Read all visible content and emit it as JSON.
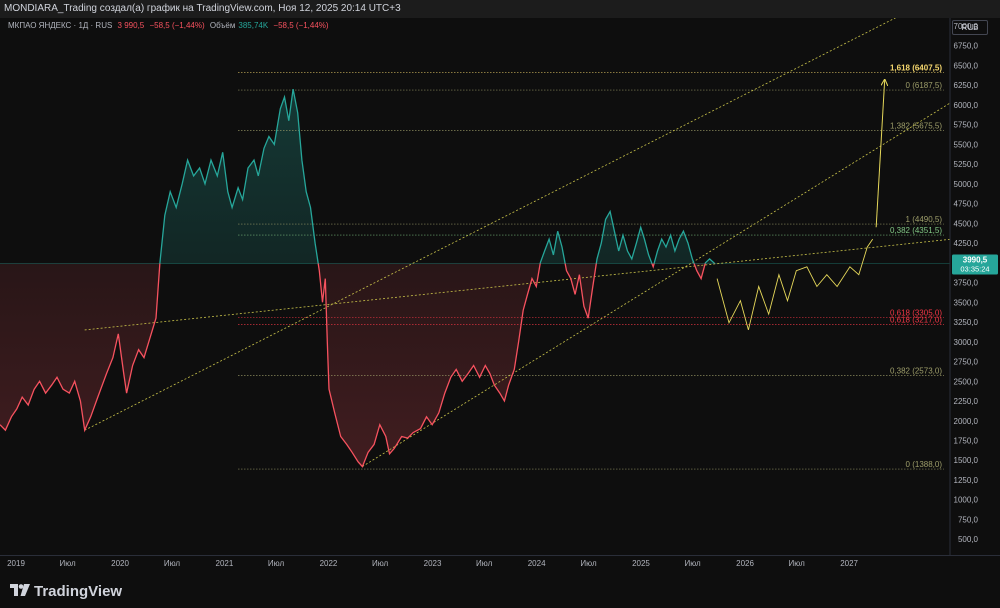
{
  "header": {
    "title": "MONDIARA_Trading создал(а) график на TradingView.com, Ноя 12, 2025 20:14 UTC+3"
  },
  "legend": {
    "symbol": "МКПАО ЯНДЕКС · 1Д · RUS",
    "price": "3 990,5",
    "change": "−58,5 (−1,44%)",
    "volume_label": "Объём",
    "volume_value": "385,74K",
    "volume_change": "−58,5 (−1,44%)"
  },
  "currency": "RUB",
  "price_tag": {
    "price": "3990,5",
    "countdown": "03:35:24"
  },
  "footer": {
    "brand": "TradingView",
    "logo_icon": "tradingview-logo-icon"
  },
  "colors": {
    "bull": "#26a69a",
    "bear": "#f7525f",
    "fib_line": "#9e9e6a",
    "fib_highlight": "#f5d76e",
    "fib_red": "#f23645",
    "fib_green": "#81c784",
    "trend": "#c9c34a"
  },
  "chart_data": {
    "type": "line",
    "title": "",
    "xlabel": "",
    "ylabel": "",
    "ylim": [
      300,
      7100
    ],
    "y_ticks": [
      500,
      750,
      1000,
      1250,
      1500,
      1750,
      2000,
      2250,
      2500,
      2750,
      3000,
      3250,
      3500,
      3750,
      4000,
      4250,
      4500,
      4750,
      5000,
      5250,
      5500,
      5750,
      6000,
      6250,
      6500,
      6750,
      7000
    ],
    "y_tick_labels": [
      "500,0",
      "750,0",
      "1000,0",
      "1250,0",
      "1500,0",
      "1750,0",
      "2000,0",
      "2250,0",
      "2500,0",
      "2750,0",
      "3000,0",
      "3250,0",
      "3500,0",
      "3750,0",
      "4000,0",
      "4250,0",
      "4500,0",
      "4750,0",
      "5000,0",
      "5250,0",
      "5500,0",
      "5750,0",
      "6000,0",
      "6250,0",
      "6500,0",
      "6750,0",
      "7000,0"
    ],
    "x_range": [
      "2019-01-01",
      "2028-02-15"
    ],
    "x_ticks": [
      {
        "date": "2019-01-01",
        "label": "2019"
      },
      {
        "date": "2019-07-01",
        "label": "Июл"
      },
      {
        "date": "2020-01-01",
        "label": "2020"
      },
      {
        "date": "2020-07-01",
        "label": "Июл"
      },
      {
        "date": "2021-01-01",
        "label": "2021"
      },
      {
        "date": "2021-07-01",
        "label": "Июл"
      },
      {
        "date": "2022-01-01",
        "label": "2022"
      },
      {
        "date": "2022-07-01",
        "label": "Июл"
      },
      {
        "date": "2023-01-01",
        "label": "2023"
      },
      {
        "date": "2023-07-01",
        "label": "Июл"
      },
      {
        "date": "2024-01-01",
        "label": "2024"
      },
      {
        "date": "2024-07-01",
        "label": "Июл"
      },
      {
        "date": "2025-01-01",
        "label": "2025"
      },
      {
        "date": "2025-07-01",
        "label": "Июл"
      },
      {
        "date": "2026-01-01",
        "label": "2026"
      },
      {
        "date": "2026-07-01",
        "label": "Июл"
      },
      {
        "date": "2027-01-01",
        "label": "2027"
      }
    ],
    "baseline": 3990.5,
    "series": [
      {
        "name": "МКПАО ЯНДЕКС",
        "points": [
          [
            "2019-01-01",
            1950
          ],
          [
            "2019-01-20",
            1880
          ],
          [
            "2019-02-10",
            2050
          ],
          [
            "2019-03-01",
            2150
          ],
          [
            "2019-03-20",
            2300
          ],
          [
            "2019-04-10",
            2200
          ],
          [
            "2019-05-01",
            2400
          ],
          [
            "2019-05-20",
            2500
          ],
          [
            "2019-06-10",
            2350
          ],
          [
            "2019-07-01",
            2450
          ],
          [
            "2019-07-20",
            2550
          ],
          [
            "2019-08-10",
            2400
          ],
          [
            "2019-09-01",
            2350
          ],
          [
            "2019-09-20",
            2500
          ],
          [
            "2019-10-10",
            2250
          ],
          [
            "2019-10-25",
            1880
          ],
          [
            "2019-11-15",
            2050
          ],
          [
            "2019-12-10",
            2300
          ],
          [
            "2020-01-10",
            2600
          ],
          [
            "2020-02-01",
            2800
          ],
          [
            "2020-02-20",
            3100
          ],
          [
            "2020-03-10",
            2600
          ],
          [
            "2020-03-20",
            2350
          ],
          [
            "2020-04-10",
            2700
          ],
          [
            "2020-05-01",
            2900
          ],
          [
            "2020-05-20",
            2800
          ],
          [
            "2020-06-10",
            3050
          ],
          [
            "2020-07-01",
            3300
          ],
          [
            "2020-07-15",
            4000
          ],
          [
            "2020-08-01",
            4600
          ],
          [
            "2020-08-20",
            4900
          ],
          [
            "2020-09-10",
            4700
          ],
          [
            "2020-10-01",
            5000
          ],
          [
            "2020-10-20",
            5300
          ],
          [
            "2020-11-10",
            5100
          ],
          [
            "2020-12-01",
            5200
          ],
          [
            "2020-12-20",
            5000
          ],
          [
            "2021-01-10",
            5300
          ],
          [
            "2021-02-01",
            5100
          ],
          [
            "2021-02-20",
            5400
          ],
          [
            "2021-03-10",
            4900
          ],
          [
            "2021-03-25",
            4700
          ],
          [
            "2021-04-15",
            4950
          ],
          [
            "2021-05-01",
            4800
          ],
          [
            "2021-05-20",
            5200
          ],
          [
            "2021-06-10",
            5300
          ],
          [
            "2021-06-25",
            5100
          ],
          [
            "2021-07-15",
            5450
          ],
          [
            "2021-08-01",
            5600
          ],
          [
            "2021-08-20",
            5500
          ],
          [
            "2021-09-10",
            5950
          ],
          [
            "2021-09-25",
            6100
          ],
          [
            "2021-10-10",
            5800
          ],
          [
            "2021-10-25",
            6200
          ],
          [
            "2021-11-10",
            5900
          ],
          [
            "2021-11-25",
            5300
          ],
          [
            "2021-12-10",
            4900
          ],
          [
            "2021-12-25",
            4700
          ],
          [
            "2022-01-10",
            4250
          ],
          [
            "2022-01-25",
            3900
          ],
          [
            "2022-02-05",
            3500
          ],
          [
            "2022-02-15",
            3800
          ],
          [
            "2022-02-22",
            3000
          ],
          [
            "2022-02-28",
            2400
          ],
          [
            "2022-03-20",
            2100
          ],
          [
            "2022-04-10",
            1800
          ],
          [
            "2022-05-01",
            1700
          ],
          [
            "2022-05-20",
            1600
          ],
          [
            "2022-06-10",
            1480
          ],
          [
            "2022-06-25",
            1420
          ],
          [
            "2022-07-15",
            1600
          ],
          [
            "2022-08-05",
            1700
          ],
          [
            "2022-08-25",
            1950
          ],
          [
            "2022-09-15",
            1800
          ],
          [
            "2022-09-28",
            1580
          ],
          [
            "2022-10-15",
            1650
          ],
          [
            "2022-11-10",
            1800
          ],
          [
            "2022-12-01",
            1780
          ],
          [
            "2022-12-20",
            1850
          ],
          [
            "2023-01-15",
            1900
          ],
          [
            "2023-02-05",
            2050
          ],
          [
            "2023-02-25",
            1950
          ],
          [
            "2023-03-20",
            2100
          ],
          [
            "2023-04-10",
            2350
          ],
          [
            "2023-05-01",
            2550
          ],
          [
            "2023-05-20",
            2650
          ],
          [
            "2023-06-10",
            2500
          ],
          [
            "2023-07-01",
            2600
          ],
          [
            "2023-07-20",
            2700
          ],
          [
            "2023-08-10",
            2550
          ],
          [
            "2023-08-30",
            2700
          ],
          [
            "2023-09-15",
            2600
          ],
          [
            "2023-10-01",
            2450
          ],
          [
            "2023-10-20",
            2350
          ],
          [
            "2023-11-05",
            2250
          ],
          [
            "2023-11-20",
            2450
          ],
          [
            "2023-12-10",
            2650
          ],
          [
            "2023-12-25",
            3000
          ],
          [
            "2024-01-10",
            3400
          ],
          [
            "2024-01-25",
            3600
          ],
          [
            "2024-02-10",
            3800
          ],
          [
            "2024-02-25",
            3700
          ],
          [
            "2024-03-10",
            4000
          ],
          [
            "2024-03-25",
            4150
          ],
          [
            "2024-04-10",
            4300
          ],
          [
            "2024-04-25",
            4100
          ],
          [
            "2024-05-10",
            4400
          ],
          [
            "2024-05-25",
            4200
          ],
          [
            "2024-06-10",
            3900
          ],
          [
            "2024-06-25",
            3800
          ],
          [
            "2024-07-10",
            3600
          ],
          [
            "2024-07-25",
            3850
          ],
          [
            "2024-08-10",
            3450
          ],
          [
            "2024-08-25",
            3300
          ],
          [
            "2024-09-10",
            3700
          ],
          [
            "2024-09-25",
            4050
          ],
          [
            "2024-10-10",
            4250
          ],
          [
            "2024-10-25",
            4550
          ],
          [
            "2024-11-10",
            4650
          ],
          [
            "2024-11-25",
            4400
          ],
          [
            "2024-12-10",
            4150
          ],
          [
            "2024-12-25",
            4350
          ],
          [
            "2025-01-10",
            4150
          ],
          [
            "2025-01-25",
            4050
          ],
          [
            "2025-02-10",
            4250
          ],
          [
            "2025-02-25",
            4450
          ],
          [
            "2025-03-10",
            4300
          ],
          [
            "2025-03-25",
            4100
          ],
          [
            "2025-04-10",
            3950
          ],
          [
            "2025-04-25",
            4150
          ],
          [
            "2025-05-10",
            4300
          ],
          [
            "2025-05-25",
            4200
          ],
          [
            "2025-06-10",
            4350
          ],
          [
            "2025-06-25",
            4150
          ],
          [
            "2025-07-10",
            4300
          ],
          [
            "2025-07-25",
            4400
          ],
          [
            "2025-08-10",
            4250
          ],
          [
            "2025-08-25",
            4050
          ],
          [
            "2025-09-10",
            3900
          ],
          [
            "2025-09-25",
            3800
          ],
          [
            "2025-10-10",
            4000
          ],
          [
            "2025-10-25",
            4050
          ],
          [
            "2025-11-12",
            3990.5
          ]
        ]
      }
    ],
    "fibonacci": [
      {
        "label": "1,618 (6407,5)",
        "value": 6407.5,
        "style": "highlight"
      },
      {
        "label": "0 (6187,5)",
        "value": 6187.5,
        "style": "normal"
      },
      {
        "label": "1,382 (5675,5)",
        "value": 5675.5,
        "style": "normal"
      },
      {
        "label": "1 (4490,5)",
        "value": 4490.5,
        "style": "normal"
      },
      {
        "label": "0,382 (4351,5)",
        "value": 4351.5,
        "style": "green"
      },
      {
        "label": "0,618 (3305,0)",
        "value": 3305.0,
        "style": "red"
      },
      {
        "label": "0,618 (3217,0)",
        "value": 3217.0,
        "style": "red"
      },
      {
        "label": "0,382 (2573,0)",
        "value": 2573.0,
        "style": "normal"
      },
      {
        "label": "0 (1388,0)",
        "value": 1388.0,
        "style": "normal"
      }
    ],
    "trendlines": [
      {
        "from": [
          "2019-10-25",
          1880
        ],
        "to": [
          "2027-01-01",
          6700
        ]
      },
      {
        "from": [
          "2022-06-25",
          1420
        ],
        "to": [
          "2027-12-31",
          5920
        ]
      },
      {
        "from": [
          "2019-10-25",
          3150
        ],
        "to": [
          "2027-12-31",
          4280
        ]
      }
    ],
    "projection": [
      [
        "2025-11-20",
        3800
      ],
      [
        "2026-01-01",
        3240
      ],
      [
        "2026-02-10",
        3520
      ],
      [
        "2026-03-10",
        3150
      ],
      [
        "2026-04-15",
        3700
      ],
      [
        "2026-05-20",
        3350
      ],
      [
        "2026-06-25",
        3850
      ],
      [
        "2026-07-25",
        3520
      ],
      [
        "2026-08-25",
        3900
      ],
      [
        "2026-10-01",
        3950
      ],
      [
        "2026-11-05",
        3700
      ],
      [
        "2026-12-10",
        3850
      ],
      [
        "2027-01-15",
        3700
      ],
      [
        "2027-03-01",
        3950
      ],
      [
        "2027-04-01",
        3850
      ],
      [
        "2027-05-01",
        4200
      ],
      [
        "2027-05-20",
        4300
      ]
    ],
    "target_arrow": {
      "from": [
        "2027-06-01",
        4450
      ],
      "to": [
        "2027-07-01",
        6320
      ]
    }
  }
}
